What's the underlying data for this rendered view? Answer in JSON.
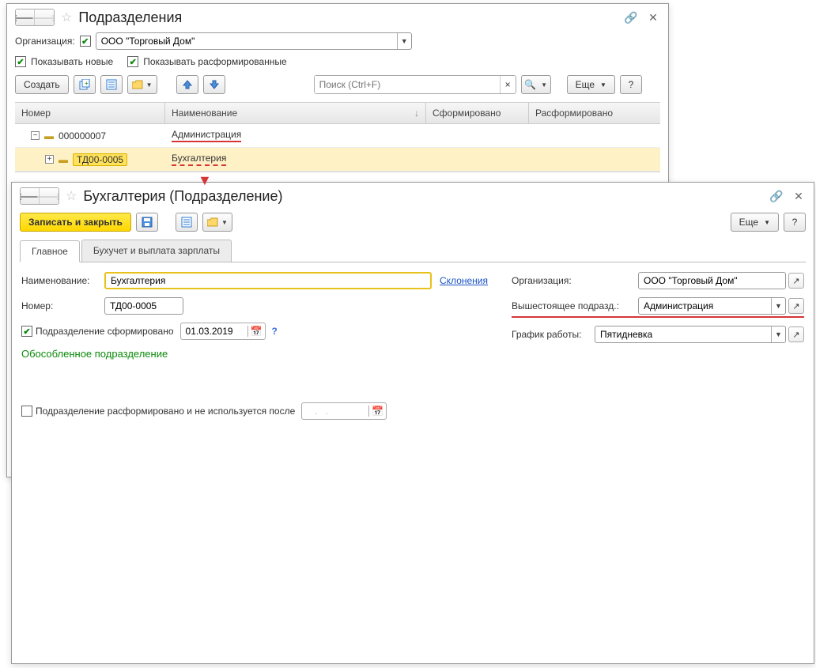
{
  "win1": {
    "title": "Подразделения",
    "org_label": "Организация:",
    "org_value": "ООО \"Торговый Дом\"",
    "show_new": "Показывать новые",
    "show_disbanded": "Показывать расформированные",
    "create": "Создать",
    "search_placeholder": "Поиск (Ctrl+F)",
    "more": "Еще",
    "columns": {
      "num": "Номер",
      "name": "Наименование",
      "formed": "Сформировано",
      "disbanded": "Расформировано"
    },
    "rows": [
      {
        "num": "000000007",
        "name": "Администрация"
      },
      {
        "num": "ТД00-0005",
        "name": "Бухгалтерия"
      }
    ]
  },
  "win2": {
    "title": "Бухгалтерия (Подразделение)",
    "save_close": "Записать и закрыть",
    "more": "Еще",
    "tabs": {
      "main": "Главное",
      "acc": "Бухучет и выплата зарплаты"
    },
    "name_label": "Наименование:",
    "name_value": "Бухгалтерия",
    "declension": "Склонения",
    "num_label": "Номер:",
    "num_value": "ТД00-0005",
    "org_label": "Организация:",
    "org_value": "ООО \"Торговый Дом\"",
    "parent_label": "Вышестоящее подразд.:",
    "parent_value": "Администрация",
    "schedule_label": "График работы:",
    "schedule_value": "Пятидневка",
    "formed_label": "Подразделение сформировано",
    "formed_date": "01.03.2019",
    "sep_title": "Обособленное подразделение",
    "disbanded_label": "Подразделение расформировано и не используется после",
    "disbanded_date": "   .   .   "
  }
}
